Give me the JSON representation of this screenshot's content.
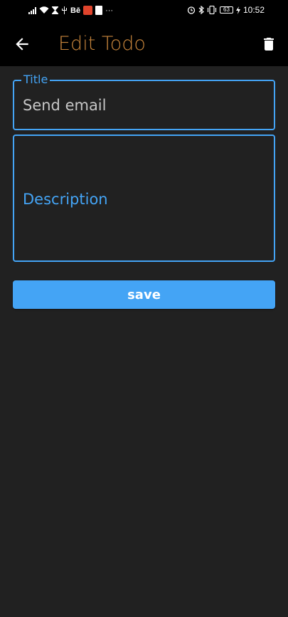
{
  "status_bar": {
    "time": "10:52",
    "battery_level": "63",
    "network_label": "Bē",
    "more_indicator": "···",
    "left_icons": [
      "signal-icon",
      "wifi-icon",
      "hourglass-icon",
      "usb-icon",
      "behance-label",
      "mail-icon",
      "document-icon",
      "more-icon"
    ],
    "right_icons": [
      "alarm-icon",
      "bluetooth-icon",
      "vibrate-icon",
      "battery-icon",
      "charging-icon"
    ]
  },
  "app_bar": {
    "title": "Edit Todo",
    "back_icon": "arrow-left-icon",
    "delete_icon": "trash-icon"
  },
  "form": {
    "title_label": "Title",
    "title_value": "Send email",
    "description_placeholder": "Description",
    "save_label": "save"
  },
  "colors": {
    "background": "#212121",
    "app_bar": "#000000",
    "title": "#c9863c",
    "accent": "#44a4f5",
    "text": "#c6c6c6"
  }
}
